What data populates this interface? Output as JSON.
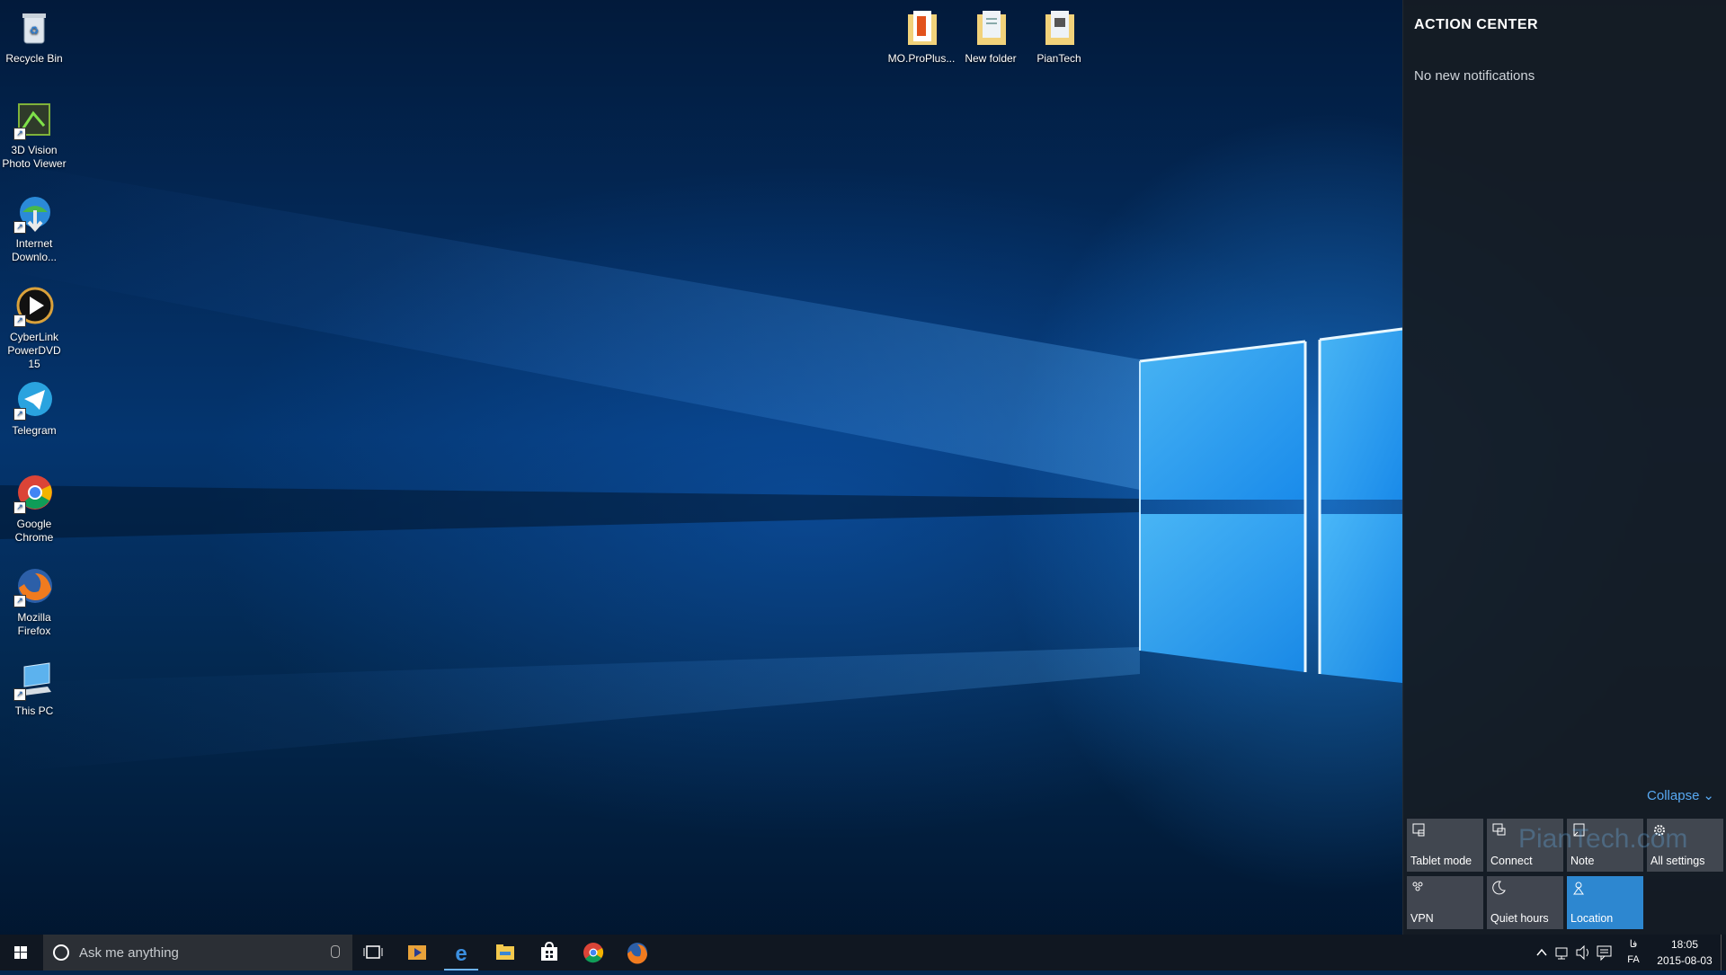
{
  "desktop": {
    "icons_left": [
      {
        "label": "Recycle Bin",
        "icon": "recycle-bin-icon"
      },
      {
        "label": "3D Vision Photo Viewer",
        "icon": "3d-vision-icon"
      },
      {
        "label": "Internet Downlo...",
        "icon": "internet-download-icon"
      },
      {
        "label": "CyberLink PowerDVD 15",
        "icon": "powerdvd-icon"
      },
      {
        "label": "Telegram",
        "icon": "telegram-icon"
      },
      {
        "label": "Google Chrome",
        "icon": "chrome-icon"
      },
      {
        "label": "Mozilla Firefox",
        "icon": "firefox-icon"
      },
      {
        "label": "This PC",
        "icon": "this-pc-icon"
      }
    ],
    "icons_top": [
      {
        "label": "MO.ProPlus...",
        "icon": "office-folder-icon"
      },
      {
        "label": "New folder",
        "icon": "folder-icon"
      },
      {
        "label": "PianTech",
        "icon": "folder-icon"
      }
    ]
  },
  "action_center": {
    "title": "ACTION CENTER",
    "empty_message": "No new notifications",
    "collapse_label": "Collapse",
    "tiles": [
      {
        "label": "Tablet mode",
        "icon": "tablet-mode-icon",
        "active": false
      },
      {
        "label": "Connect",
        "icon": "connect-icon",
        "active": false
      },
      {
        "label": "Note",
        "icon": "note-icon",
        "active": false
      },
      {
        "label": "All settings",
        "icon": "gear-icon",
        "active": false
      },
      {
        "label": "VPN",
        "icon": "vpn-icon",
        "active": false
      },
      {
        "label": "Quiet hours",
        "icon": "moon-icon",
        "active": false
      },
      {
        "label": "Location",
        "icon": "location-icon",
        "active": true
      }
    ],
    "watermark": "PianTech.com",
    "accent": "#2d87d0"
  },
  "taskbar": {
    "search_placeholder": "Ask me anything",
    "pinned": [
      "task-view-icon",
      "media-player-icon",
      "edge-icon",
      "file-explorer-icon",
      "store-icon",
      "chrome-icon",
      "firefox-icon"
    ],
    "active_app": "edge-icon",
    "tray": {
      "language_top": "فا",
      "language": "FA",
      "time": "18:05",
      "date": "2015-08-03"
    }
  }
}
